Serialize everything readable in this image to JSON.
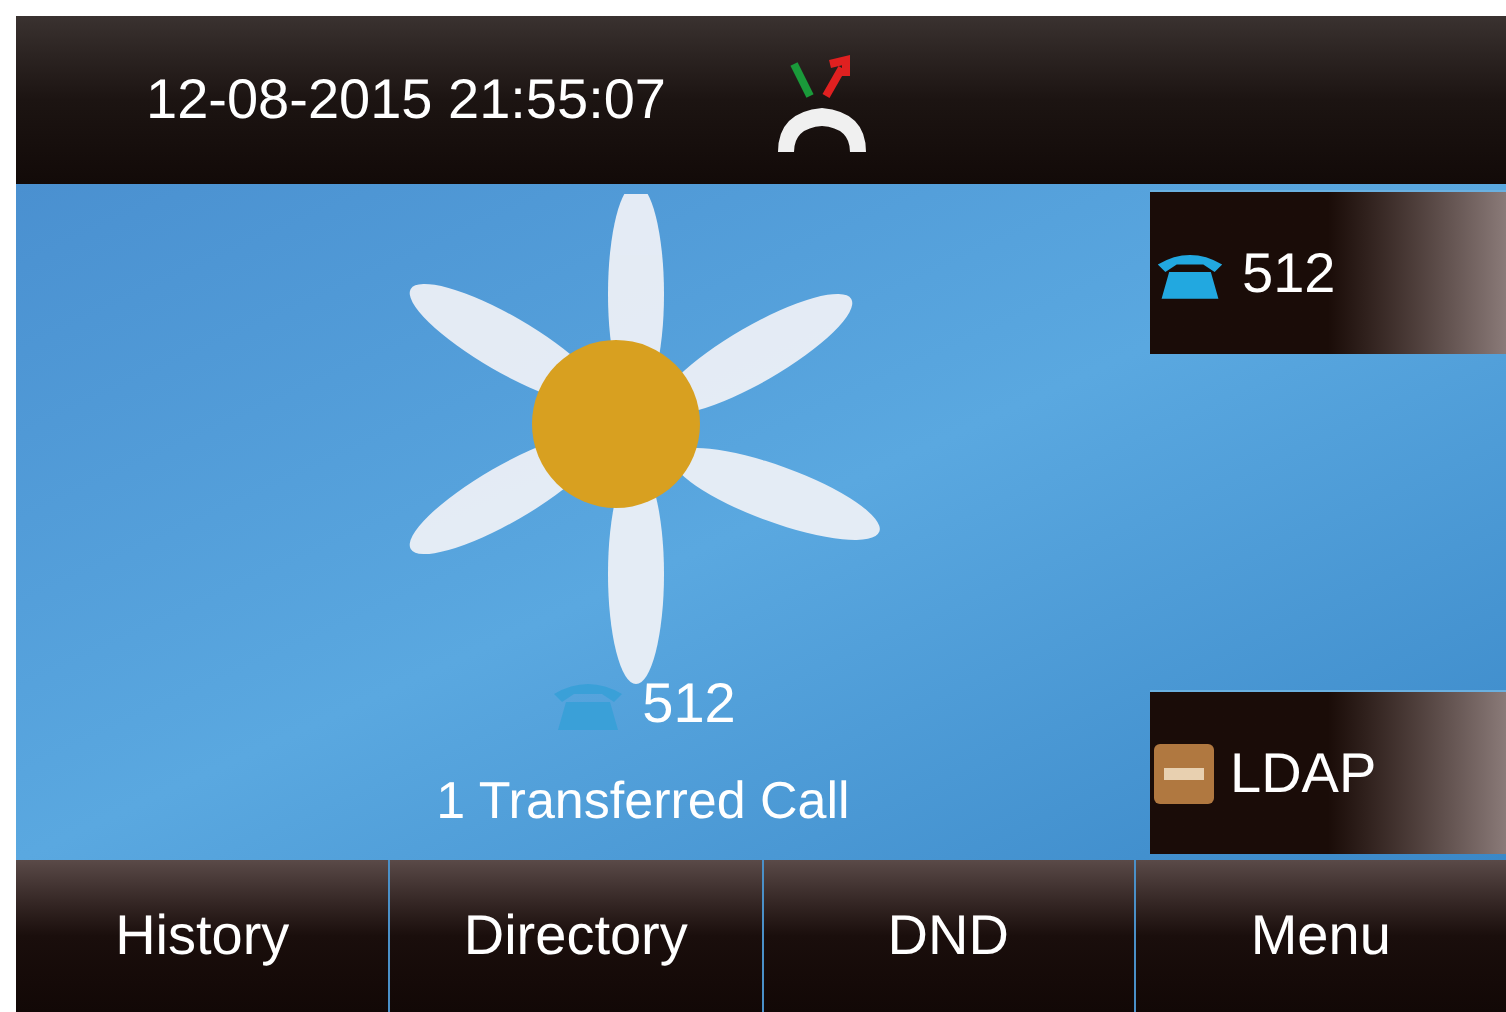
{
  "status_bar": {
    "datetime": "12-08-2015 21:55:07"
  },
  "line_keys": [
    {
      "kind": "line",
      "label": "512"
    },
    {
      "kind": "ldap",
      "label": "LDAP"
    }
  ],
  "idle": {
    "account": "512",
    "notice": "1 Transferred Call"
  },
  "softkeys": [
    "History",
    "Directory",
    "DND",
    "Menu"
  ]
}
